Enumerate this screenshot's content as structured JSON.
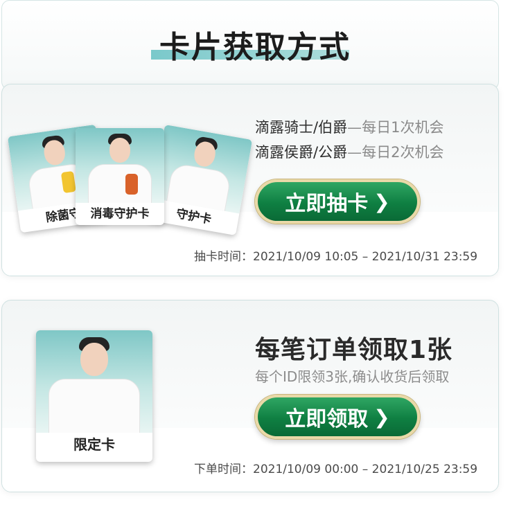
{
  "header": {
    "title": "卡片获取方式"
  },
  "draw_section": {
    "cards": [
      "除菌守",
      "消毒守护卡",
      "守护卡"
    ],
    "rule1": {
      "tier": "滴露骑士/伯爵",
      "chance": "—每日1次机会"
    },
    "rule2": {
      "tier": "滴露侯爵/公爵",
      "chance": "—每日2次机会"
    },
    "button_label": "立即抽卡",
    "button_icon": "chevron-right-icon",
    "time_text": "抽卡时间：2021/10/09 10:05 – 2021/10/31 23:59"
  },
  "order_section": {
    "card_label": "限定卡",
    "title": "每笔订单领取1张",
    "subtitle": "每个ID限领3张,确认收货后领取",
    "button_label": "立即领取",
    "button_icon": "chevron-right-icon",
    "time_text": "下单时间：2021/10/09 00:00 – 2021/10/25 23:59"
  },
  "colors": {
    "accent_green": "#0f7f42",
    "button_border_gold": "#e9d9a8",
    "title_highlight": "#6cc3c5"
  }
}
